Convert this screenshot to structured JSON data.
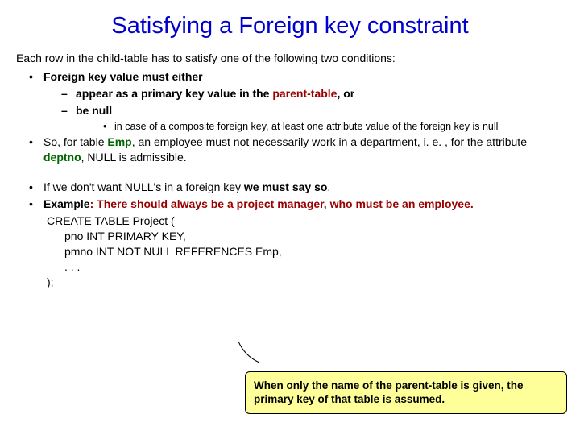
{
  "title": "Satisfying a Foreign key constraint",
  "lead": "Each row in the child-table has to satisfy one of the following two conditions:",
  "b1": "Foreign key value must either",
  "b1a_pre": "appear as a primary key value in the ",
  "b1a_em": "parent-table",
  "b1a_post": ", or",
  "b1b": "be null",
  "b1b_note": "in case of a composite foreign key, at least one attribute value of the foreign key is null",
  "b2_pre": "So, for table ",
  "b2_emp": "Emp",
  "b2_mid": ", an employee must not necessarily work in a department, i. e. , for the attribute ",
  "b2_deptno": "deptno",
  "b2_post": ", NULL is admissible.",
  "b3_pre": "If we don't want NULL's in a foreign key ",
  "b3_bold": "we must say so",
  "b3_post": ".",
  "b4_ex": "Example",
  "b4_text_pre": ": There should always be a project manager, who ",
  "b4_text_bold": "must",
  "b4_text_post": " be an employee.",
  "code1": "CREATE TABLE Project (",
  "code2": "pno INT PRIMARY KEY,",
  "code3": "pmno INT NOT NULL REFERENCES Emp,",
  "code4": ". . .",
  "code5": ");",
  "callout": "When only the name of the parent-table is given, the primary key of that table is assumed."
}
